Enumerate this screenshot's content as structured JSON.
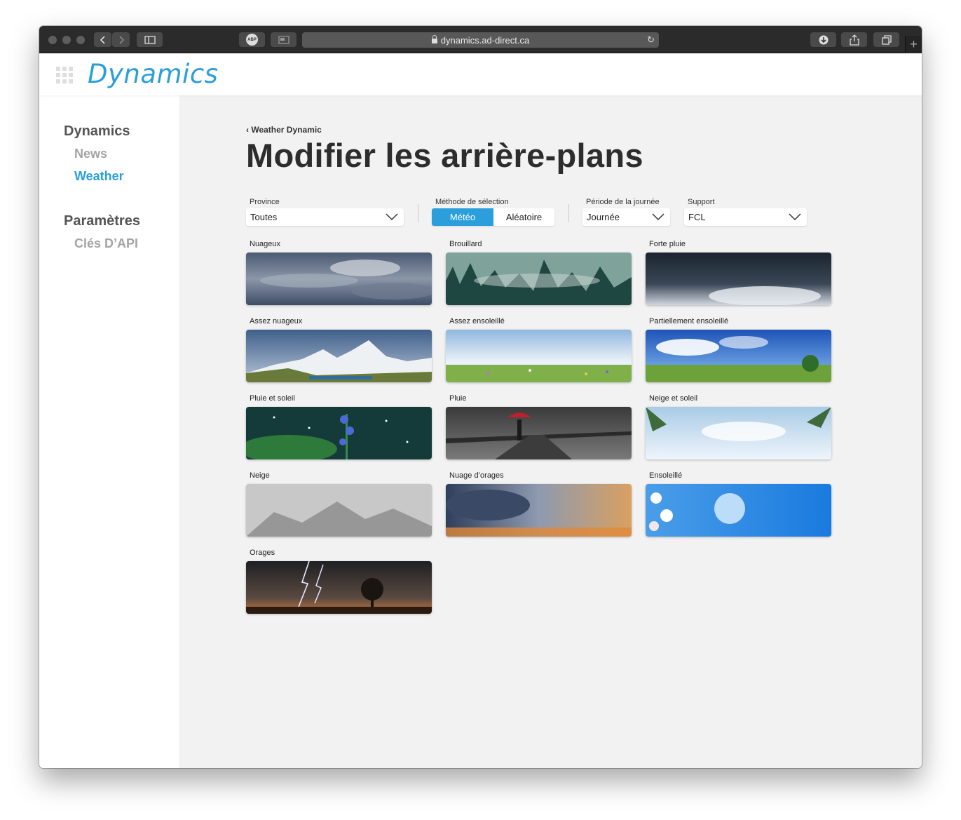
{
  "browser": {
    "url": "dynamics.ad-direct.ca",
    "abp_label": "ABP"
  },
  "app": {
    "logo": "Dynamics"
  },
  "sidebar": {
    "section1": "Dynamics",
    "items1": [
      {
        "label": "News",
        "active": false
      },
      {
        "label": "Weather",
        "active": true
      }
    ],
    "section2": "Paramètres",
    "items2": [
      {
        "label": "Clés D’API",
        "active": false
      }
    ]
  },
  "page": {
    "back_label": "Weather Dynamic",
    "title": "Modifier les arrière-plans"
  },
  "filters": {
    "province_label": "Province",
    "province_value": "Toutes",
    "method_label": "Méthode de sélection",
    "method_options": [
      "Météo",
      "Aléatoire"
    ],
    "method_selected": "Météo",
    "period_label": "Période de la journée",
    "period_value": "Journée",
    "support_label": "Support",
    "support_value": "FCL"
  },
  "backgrounds": [
    {
      "label": "Nuageux"
    },
    {
      "label": "Brouillard"
    },
    {
      "label": "Forte pluie"
    },
    {
      "label": "Assez nuageux"
    },
    {
      "label": "Assez ensoleillé"
    },
    {
      "label": "Partiellement ensoleillé"
    },
    {
      "label": "Pluie et soleil"
    },
    {
      "label": "Pluie"
    },
    {
      "label": "Neige et soleil"
    },
    {
      "label": "Neige"
    },
    {
      "label": "Nuage d’orages"
    },
    {
      "label": "Ensoleillé"
    },
    {
      "label": "Orages"
    }
  ],
  "colors": {
    "accent": "#2a9fdc",
    "sidebar_bg": "#ffffff",
    "main_bg": "#f2f2f2"
  }
}
